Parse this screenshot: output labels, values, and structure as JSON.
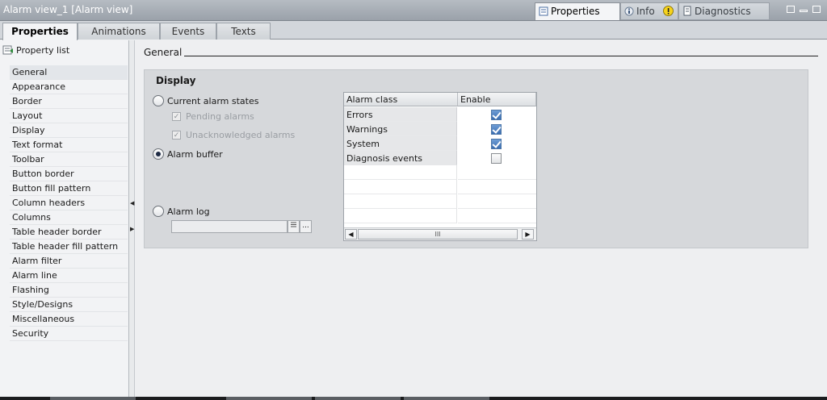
{
  "window": {
    "title": "Alarm view_1 [Alarm view]",
    "right_tabs": [
      {
        "label": "Properties",
        "active": true
      },
      {
        "label": "Info",
        "active": false
      },
      {
        "label": "Diagnostics",
        "active": false
      }
    ]
  },
  "tabs": [
    {
      "label": "Properties",
      "active": true
    },
    {
      "label": "Animations",
      "active": false
    },
    {
      "label": "Events",
      "active": false
    },
    {
      "label": "Texts",
      "active": false
    }
  ],
  "sidebar": {
    "header": "Property list",
    "items": [
      {
        "label": "General",
        "selected": true
      },
      {
        "label": "Appearance"
      },
      {
        "label": "Border"
      },
      {
        "label": "Layout"
      },
      {
        "label": "Display"
      },
      {
        "label": "Text format"
      },
      {
        "label": "Toolbar"
      },
      {
        "label": "Button border"
      },
      {
        "label": "Button fill pattern"
      },
      {
        "label": "Column headers"
      },
      {
        "label": "Columns"
      },
      {
        "label": "Table header border"
      },
      {
        "label": "Table header fill pattern"
      },
      {
        "label": "Alarm filter"
      },
      {
        "label": "Alarm line"
      },
      {
        "label": "Flashing"
      },
      {
        "label": "Style/Designs"
      },
      {
        "label": "Miscellaneous"
      },
      {
        "label": "Security"
      }
    ]
  },
  "main": {
    "section_title": "General",
    "group_title": "Display",
    "options": {
      "current_alarm_states": {
        "label": "Current alarm states",
        "selected": false
      },
      "pending_alarms": {
        "label": "Pending alarms",
        "checked": true,
        "disabled": true
      },
      "unacknowledged_alarms": {
        "label": "Unacknowledged alarms",
        "checked": true,
        "disabled": true
      },
      "alarm_buffer": {
        "label": "Alarm buffer",
        "selected": true
      },
      "alarm_log": {
        "label": "Alarm log",
        "selected": false,
        "value": ""
      }
    },
    "alarm_table": {
      "headers": [
        "Alarm class",
        "Enable"
      ],
      "rows": [
        {
          "class": "Errors",
          "enabled": true
        },
        {
          "class": "Warnings",
          "enabled": true
        },
        {
          "class": "System",
          "enabled": true
        },
        {
          "class": "Diagnosis events",
          "enabled": false
        }
      ],
      "scroll_thumb": "III"
    },
    "browse_button": "..."
  }
}
